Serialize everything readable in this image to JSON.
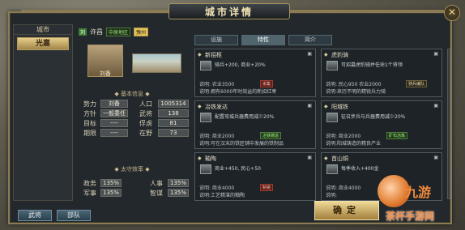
{
  "title": "城市详情",
  "sidebar": {
    "header": "城市",
    "active_tab": "光嘉"
  },
  "header": {
    "flag": "刘",
    "city": "许昌",
    "tags": [
      "中原地区",
      "豫州"
    ]
  },
  "governor_name": "刘备",
  "basic_info_title": "基本信息",
  "stats": {
    "势力": "刘备",
    "人口": "1005314",
    "方针": "一般委任",
    "武将": "138",
    "目标": "----",
    "俘虏": "81",
    "期限": "----",
    "在野": "73"
  },
  "prefect_title": "太守效率",
  "efficiency": {
    "政务": "135%",
    "人事": "135%",
    "军事": "135%",
    "智谋": "135%"
  },
  "tabs": [
    "设施",
    "特性",
    "简介"
  ],
  "cards": [
    {
      "title": "新招枢",
      "desc": "骑兵+200, 商业+20%",
      "row1": "说明: 农业3500",
      "row2": "说明:拥有6000年时效益的新招红枣",
      "badge": "采集",
      "badge_type": "red"
    },
    {
      "title": "虎豹骑",
      "desc": "可招募虎豹骑并任命1个将领",
      "row1": "说明: 民心950 农业2000",
      "row2": "说明:来历不明的精锐兵力骑",
      "badge": "骑兵编队",
      "badge_type": "dark"
    },
    {
      "title": "冶铁发达",
      "desc": "配置攻城兵器费用减少20%",
      "row1": "说明: 商业2000",
      "row2": "说明:可在汉末的铁匠铺中发展的铁制品",
      "badge": "冶铁铸造",
      "badge_type": "green"
    },
    {
      "title": "阳城铁",
      "desc": "征召步兵与兵器费用减少20%",
      "row1": "说明: 商业2000",
      "row2": "说明:阳城铸造的精良产业",
      "badge": "矿石冶炼",
      "badge_type": "green"
    },
    {
      "title": "釉陶",
      "desc": "商业+450, 民心+50",
      "row1": "说明: 商业4000",
      "row2": "说明:工艺精湛的釉陶",
      "badge": "制瓷",
      "badge_type": "red"
    },
    {
      "title": "首山铜",
      "desc": "每季收入+400金",
      "row1": "说明: 商业4000",
      "row2": "说明:",
      "badge": "",
      "badge_type": "dark"
    }
  ],
  "card_tips": {
    "tip": "◆"
  },
  "bottom_buttons": [
    "武将",
    "部队"
  ],
  "confirm": "确定",
  "watermark": {
    "text": "九游",
    "sub": "茶杯手游网"
  }
}
